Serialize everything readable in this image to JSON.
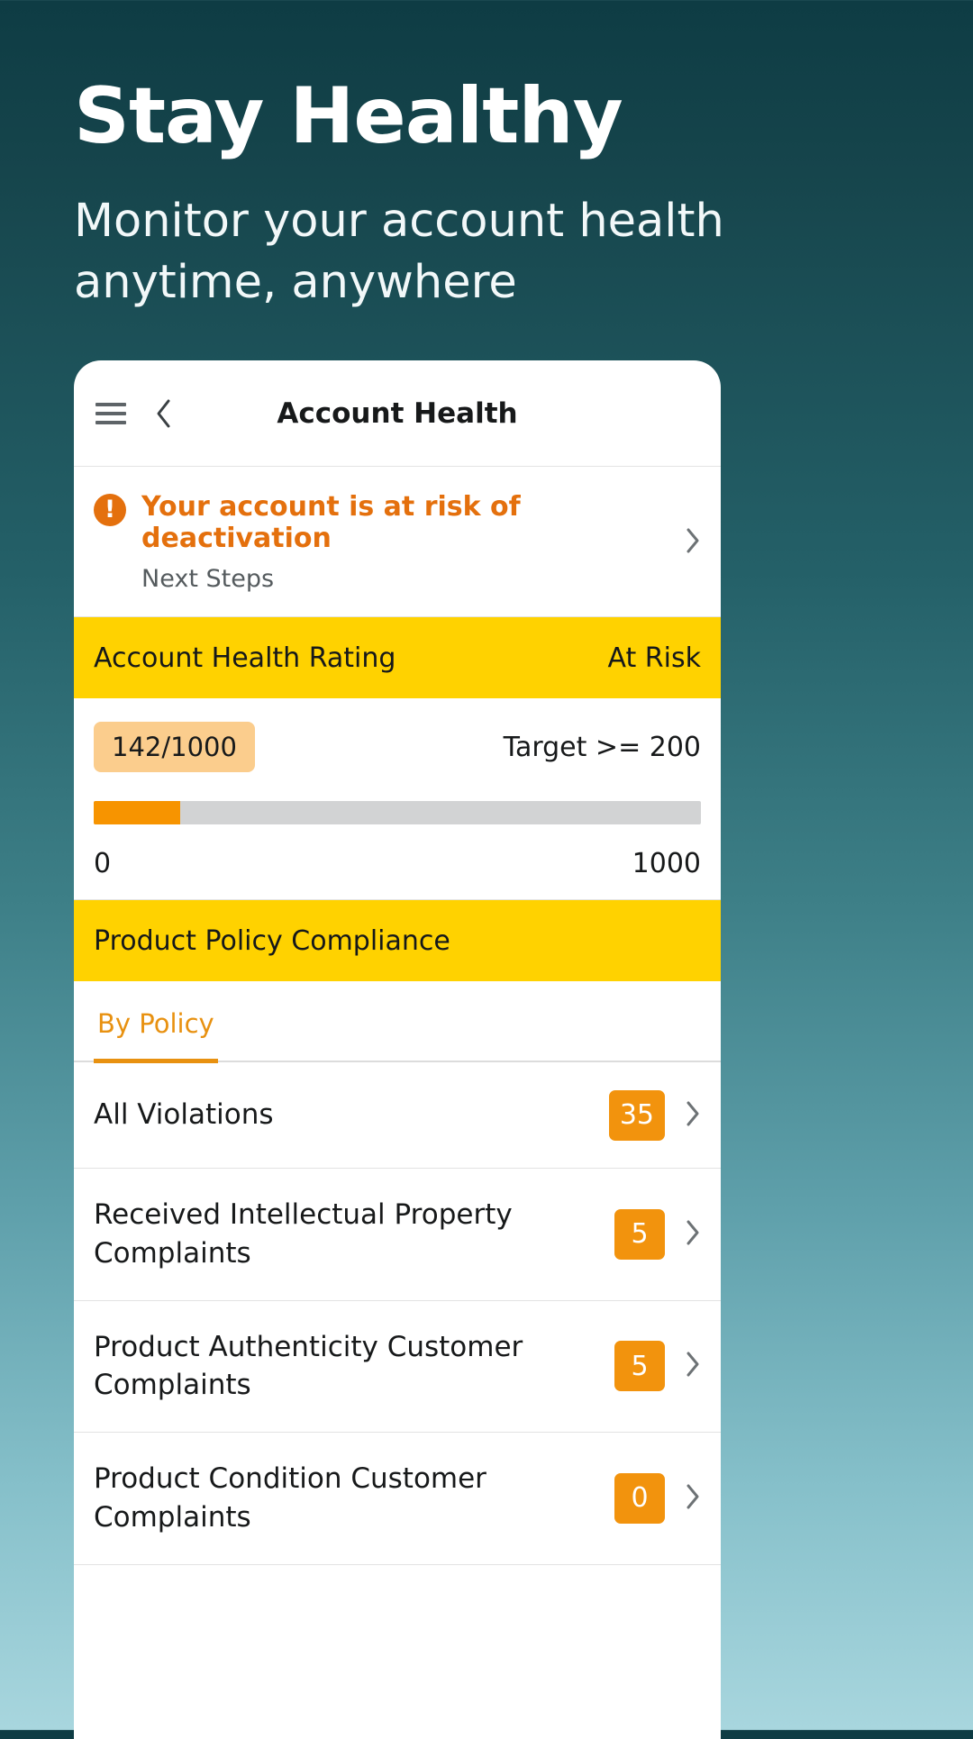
{
  "hero": {
    "title": "Stay Healthy",
    "subtitle": "Monitor your account health anytime, anywhere"
  },
  "colors": {
    "accent_orange": "#e4700d",
    "badge_orange": "#f2930d",
    "band_yellow": "#ffd200",
    "progress_fill": "#f79400",
    "pill_bg": "#fbcd8d",
    "tab_active": "#e89110"
  },
  "app": {
    "header": {
      "menu_icon": "hamburger-menu-icon",
      "back_icon": "chevron-left-icon",
      "title": "Account Health"
    },
    "alert": {
      "icon": "exclamation-circle-icon",
      "title": "Your account is at risk of deactivation",
      "subtitle": "Next Steps",
      "chevron": "chevron-right-icon"
    },
    "rating_band": {
      "label": "Account Health Rating",
      "status": "At Risk"
    },
    "score": {
      "value_label": "142/1000",
      "target_label": "Target >= 200",
      "scale_min": "0",
      "scale_max": "1000",
      "progress_percent": 14.2
    },
    "compliance_band": {
      "label": "Product Policy Compliance"
    },
    "tabs": [
      {
        "label": "By Policy",
        "active": true
      }
    ],
    "violations": [
      {
        "label": "All Violations",
        "count": "35",
        "chevron": "chevron-right-icon"
      },
      {
        "label": "Received Intellectual Property Complaints",
        "count": "5",
        "chevron": "chevron-right-icon"
      },
      {
        "label": "Product Authenticity Customer Complaints",
        "count": "5",
        "chevron": "chevron-right-icon"
      },
      {
        "label": "Product Condition Customer Complaints",
        "count": "0",
        "chevron": "chevron-right-icon"
      }
    ]
  }
}
